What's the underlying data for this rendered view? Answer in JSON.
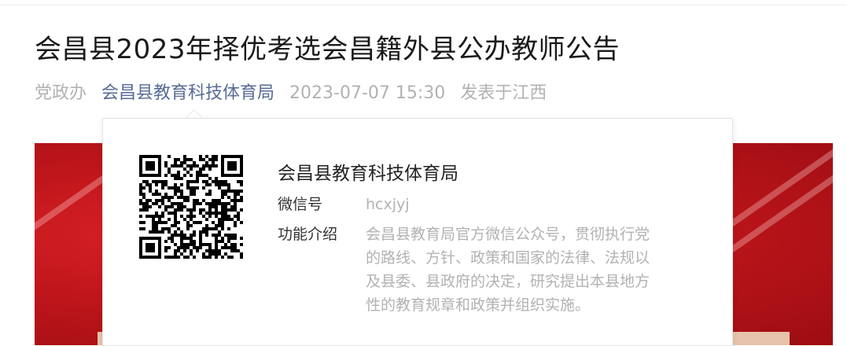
{
  "article": {
    "title": "会昌县2023年择优考选会昌籍外县公办教师公告",
    "author": "党政办",
    "account_name": "会昌县教育科技体育局",
    "datetime": "2023-07-07 15:30",
    "location": "发表于江西"
  },
  "profile_card": {
    "name": "会昌县教育科技体育局",
    "wechat_label": "微信号",
    "wechat_id": "hcxjyj",
    "intro_label": "功能介绍",
    "intro_lines": [
      "会昌县教育局官方微信公众号，贯彻执行党",
      "的路线、方针、政策和国家的法律、法规以",
      "及县委、县政府的决定，研究提出本县地方",
      "性的教育规章和政策并组织实施。"
    ],
    "qr_icon": "qr-code-icon"
  },
  "colors": {
    "link": "#576b95",
    "muted": "#b2b2b2",
    "banner_red": "#c0161b"
  }
}
